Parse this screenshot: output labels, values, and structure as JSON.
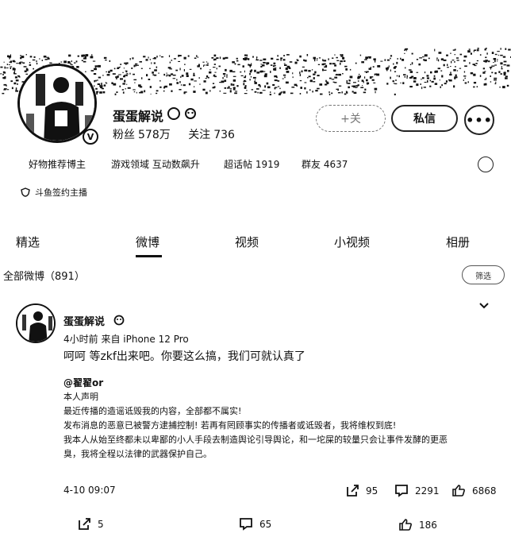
{
  "profile": {
    "name": "蛋蛋解说",
    "verified_mark": "V",
    "fans_label": "粉丝",
    "fans_value": "578万",
    "follow_label": "关注",
    "follow_value": "736",
    "follow_button": "+关",
    "message_button": "私信",
    "more_button": "•••"
  },
  "tags": [
    {
      "label": "好物推荐博主"
    },
    {
      "label": "游戏领域 互动数飙升"
    },
    {
      "label": "超话帖 1919"
    },
    {
      "label": "群友 4637"
    }
  ],
  "sign": {
    "label": "斗鱼签约主播"
  },
  "tabs": [
    {
      "label": "精选"
    },
    {
      "label": "微博"
    },
    {
      "label": "视频"
    },
    {
      "label": "小视频"
    },
    {
      "label": "相册"
    }
  ],
  "feed": {
    "all_label": "全部微博（891）",
    "filter_label": "筛选"
  },
  "post": {
    "author": "蛋蛋解说",
    "time": "4小时前",
    "source": "来自 iPhone 12 Pro",
    "text": "呵呵 等zkf出来吧。你要这么搞，我们可就认真了",
    "quote": {
      "author": "@翟翟or",
      "lines": [
        "本人声明",
        "最近传播的造谣诋毁我的内容，全部都不属实!",
        "发布消息的恶意已被警方逮捕控制! 若再有罔顾事实的传播者或诋毁者，我将维权到底!",
        "我本人从始至终都未以卑鄙的小人手段去制造舆论引导舆论，和一坨屎的较量只会让事件发酵的更恶",
        "臭，我将全程以法律的武器保护自己。"
      ],
      "date": "4-10 09:07",
      "reposts": "95",
      "comments": "2291",
      "likes": "6868"
    },
    "reposts": "5",
    "comments": "65",
    "likes": "186"
  }
}
